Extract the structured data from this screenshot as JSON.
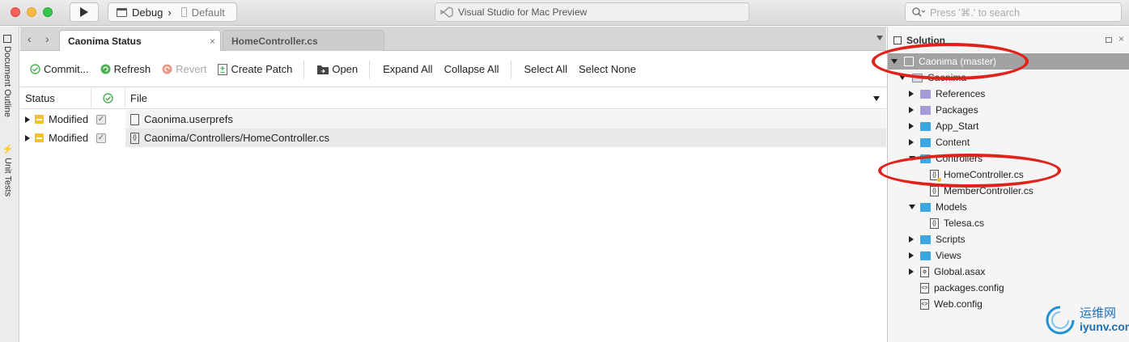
{
  "window": {
    "run_icon": "play-icon",
    "config": "Debug",
    "config_sep": "›",
    "target": "Default",
    "center_title": "Visual Studio for Mac Preview",
    "search_placeholder": "Press '⌘.' to search"
  },
  "sidebar_left": {
    "items": [
      {
        "label": "Document Outline",
        "icon": "document-outline-icon"
      },
      {
        "label": "Unit Tests",
        "icon": "unit-tests-icon"
      }
    ]
  },
  "tabs": [
    {
      "label": "Caonima Status",
      "active": true,
      "close": "×"
    },
    {
      "label": "HomeController.cs",
      "active": false
    }
  ],
  "toolbar": {
    "commit": "Commit...",
    "refresh": "Refresh",
    "revert": "Revert",
    "create_patch": "Create Patch",
    "open": "Open",
    "expand_all": "Expand All",
    "collapse_all": "Collapse All",
    "select_all": "Select All",
    "select_none": "Select None"
  },
  "table": {
    "headers": {
      "status": "Status",
      "file": "File"
    },
    "rows": [
      {
        "status": "Modified",
        "checked": true,
        "file": "Caonima.userprefs",
        "icon": "file-icon"
      },
      {
        "status": "Modified",
        "checked": true,
        "file": "Caonima/Controllers/HomeController.cs",
        "icon": "csharp-file-icon"
      }
    ]
  },
  "solution": {
    "title": "Solution",
    "tree": [
      {
        "label": "Caonima (master)",
        "indent": 0,
        "expanded": true,
        "icon": "solution-icon",
        "selected": true
      },
      {
        "label": "Caonima",
        "indent": 1,
        "expanded": true,
        "icon": "project-icon"
      },
      {
        "label": "References",
        "indent": 2,
        "expanded": false,
        "icon": "references-folder-icon"
      },
      {
        "label": "Packages",
        "indent": 2,
        "expanded": false,
        "icon": "packages-folder-icon"
      },
      {
        "label": "App_Start",
        "indent": 2,
        "expanded": false,
        "icon": "folder-icon"
      },
      {
        "label": "Content",
        "indent": 2,
        "expanded": false,
        "icon": "folder-icon"
      },
      {
        "label": "Controllers",
        "indent": 2,
        "expanded": true,
        "icon": "folder-icon"
      },
      {
        "label": "HomeController.cs",
        "indent": 3,
        "icon": "csharp-file-icon",
        "modified": true
      },
      {
        "label": "MemberController.cs",
        "indent": 3,
        "icon": "csharp-file-icon"
      },
      {
        "label": "Models",
        "indent": 2,
        "expanded": true,
        "icon": "folder-icon"
      },
      {
        "label": "Telesa.cs",
        "indent": 3,
        "icon": "csharp-file-icon"
      },
      {
        "label": "Scripts",
        "indent": 2,
        "expanded": false,
        "icon": "folder-icon"
      },
      {
        "label": "Views",
        "indent": 2,
        "expanded": false,
        "icon": "folder-icon"
      },
      {
        "label": "Global.asax",
        "indent": 2,
        "expanded": false,
        "icon": "asax-file-icon"
      },
      {
        "label": "packages.config",
        "indent": 2,
        "icon": "config-file-icon"
      },
      {
        "label": "Web.config",
        "indent": 2,
        "icon": "config-file-icon"
      }
    ]
  },
  "watermark": {
    "cn": "运维网",
    "domain": "iyunv.com"
  },
  "colors": {
    "accent_folder": "#3da6e0",
    "modified": "#f2c12e",
    "annotation": "#e0221b"
  }
}
